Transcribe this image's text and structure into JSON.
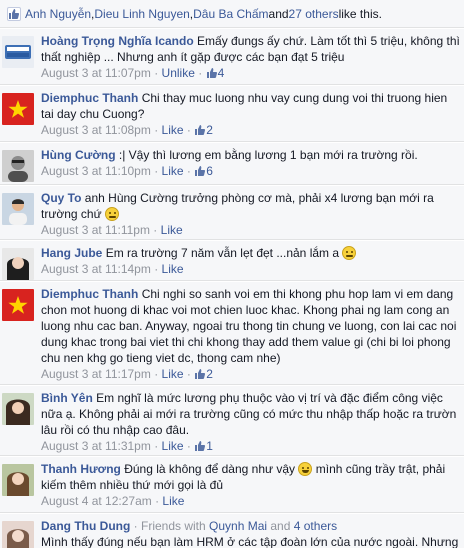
{
  "likes_bar": {
    "people": [
      "Anh Nguyễn",
      "Dieu Linh Nguyen",
      "Dâu Ba Chấm"
    ],
    "sep1": ", ",
    "sep2": ", ",
    "and_text": " and ",
    "others": "27 others",
    "suffix": " like this."
  },
  "comments": [
    {
      "name": "Hoàng Trọng Nghĩa Icando",
      "text": "Emấy đungs ấy chứ. Làm tốt thì 5 triệu, không thì thất nghiệp ... Nhưng anh ít gặp được các bạn đạt 5 triệu",
      "time": "August 3 at 11:07pm",
      "action": "Unlike",
      "likes": "4"
    },
    {
      "name": "Diemphuc Thanh",
      "text": "Chi thay muc luong nhu vay cung dung voi thi truong hien tai day chu Cuong?",
      "time": "August 3 at 11:08pm",
      "action": "Like",
      "likes": "2"
    },
    {
      "name": "Hùng Cường",
      "text": ":| Vậy thì lương em bằng lương 1 bạn mới ra trường rồi.",
      "time": "August 3 at 11:10pm",
      "action": "Like",
      "likes": "6"
    },
    {
      "name": "Quy To",
      "text": "anh Hùng Cường trưởng phòng cơ mà, phải x4 lương bạn mới ra trường chứ",
      "time": "August 3 at 11:11pm",
      "action": "Like",
      "likes": ""
    },
    {
      "name": "Hang Jube",
      "text": "Em ra trường 7 năm vẫn lẹt đẹt ...nản lắm a",
      "time": "August 3 at 11:14pm",
      "action": "Like",
      "likes": ""
    },
    {
      "name": "Diemphuc Thanh",
      "text": "Chi nghi so sanh voi em thi khong phu hop lam vi em dang chon mot huong di khac voi mot chien luoc khac. Khong phai ng lam cong an luong nhu cac ban. Anyway, ngoai tru thong tin chung ve luong, con lai cac noi dung khac trong bai viet thi chi khong thay add them value gi (chi bi loi phong chu nen khg go tieng viet dc, thong cam nhe)",
      "time": "August 3 at 11:17pm",
      "action": "Like",
      "likes": "2"
    },
    {
      "name": "Bình Yên",
      "text": "Em nghĩ là mức lương phụ thuộc vào vị trí và đặc điểm công việc nữa ạ. Không phải ai mới ra trường cũng có mức thu nhập thấp hoặc ra trườn lâu rồi có thu nhập cao đâu.",
      "time": "August 3 at 11:31pm",
      "action": "Like",
      "likes": "1"
    },
    {
      "name": "Thanh Hương",
      "text_a": "Đúng là không để dàng như vậy",
      "text_b": "mình cũng trầy trật, phải kiếm thêm nhiều thứ mới gọi là đủ",
      "time": "August 4 at 12:27am",
      "action": "Like",
      "likes": ""
    },
    {
      "name": "Dang Thu Dung",
      "friends_prefix": " · Friends with ",
      "friend": "Quynh Mai",
      "friends_mid": " and ",
      "friends_others": "4 others",
      "text": "Mình thấy đúng nếu bạn làm HRM ở các tập đoàn lớn của nước ngoài. Nhưng",
      "time": "",
      "action": "",
      "likes": ""
    }
  ],
  "ui": {
    "dot": " · ",
    "brand_blue": "#3b5998",
    "meta_gray": "#90949c",
    "comment_bg": "#f6f7f9"
  }
}
